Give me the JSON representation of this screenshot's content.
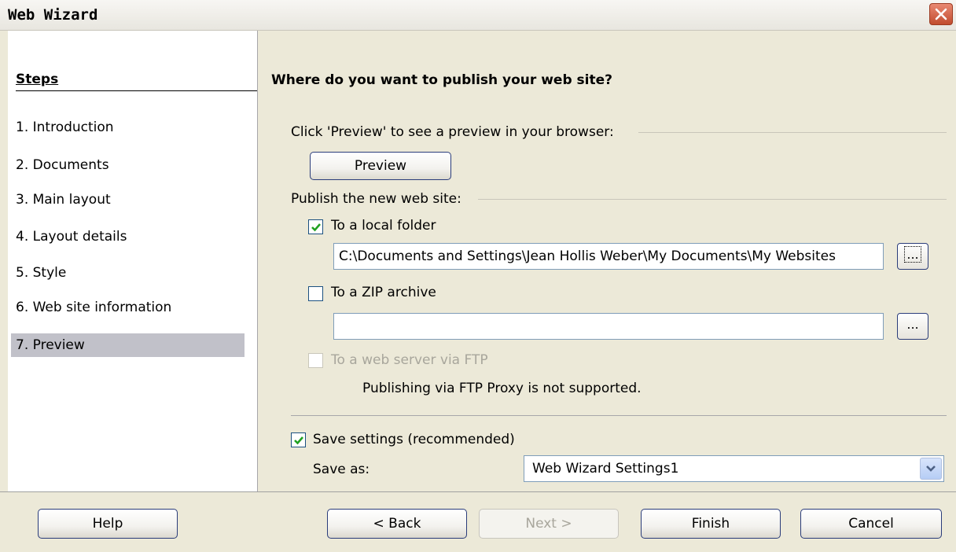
{
  "window": {
    "title": "Web Wizard"
  },
  "steps": {
    "title": "Steps",
    "items": [
      {
        "label": "1.  Introduction"
      },
      {
        "label": "2.  Documents"
      },
      {
        "label": "3.  Main layout"
      },
      {
        "label": "4.  Layout details"
      },
      {
        "label": "5.  Style"
      },
      {
        "label": "6.  Web site information"
      },
      {
        "label": "7.  Preview"
      }
    ],
    "active_index": 6
  },
  "main": {
    "heading": "Where do you want to publish your web site?",
    "preview_section_label": "Click 'Preview' to see a preview in your browser:",
    "preview_button": "Preview",
    "publish_section_label": "Publish the new web site:",
    "local_folder": {
      "label": "To a local folder",
      "checked": true,
      "path": "C:\\Documents and Settings\\Jean Hollis Weber\\My Documents\\My Websites",
      "browse": "..."
    },
    "zip_archive": {
      "label": "To a ZIP archive",
      "checked": false,
      "path": "",
      "browse": "..."
    },
    "ftp": {
      "label": "To a web server via FTP",
      "checked": false,
      "enabled": false,
      "note": "Publishing via FTP Proxy is not supported."
    },
    "save_settings": {
      "label": "Save settings (recommended)",
      "checked": true
    },
    "save_as": {
      "label": "Save as:",
      "value": "Web Wizard Settings1"
    }
  },
  "buttons": {
    "help": "Help",
    "back": "< Back",
    "next": "Next >",
    "finish": "Finish",
    "cancel": "Cancel"
  }
}
